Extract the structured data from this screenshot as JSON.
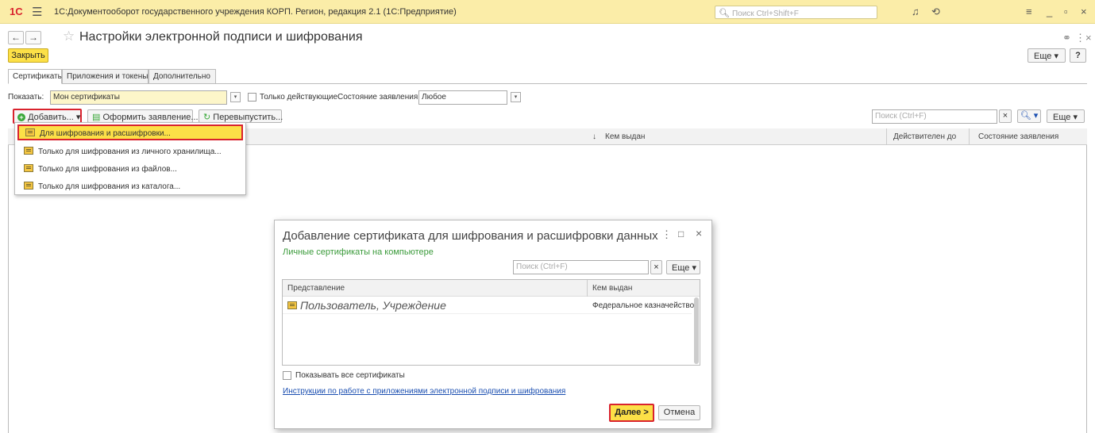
{
  "window": {
    "logo": "1С",
    "title": "1С:Документооборот государственного учреждения КОРП. Регион, редакция 2.1  (1С:Предприятие)",
    "search_placeholder": "Поиск Ctrl+Shift+F"
  },
  "page": {
    "title": "Настройки электронной подписи и шифрования",
    "close_label": "Закрыть",
    "more_label": "Еще",
    "help_label": "?"
  },
  "tabs": [
    {
      "label": "Сертификаты",
      "active": true
    },
    {
      "label": "Приложения и токены",
      "active": false
    },
    {
      "label": "Дополнительно",
      "active": false
    }
  ],
  "filter": {
    "show_label": "Показать:",
    "show_value": "Мон сертификаты",
    "only_active_label": "Только действующие",
    "state_label": "Состояние заявления:",
    "state_value": "Любое"
  },
  "toolbar": {
    "add_label": "Добавить...",
    "apply_label": "Оформить заявление...",
    "reissue_label": "Перевыпустить...",
    "search_placeholder": "Поиск (Ctrl+F)",
    "clear_label": "×",
    "more_label": "Еще"
  },
  "grid": {
    "columns": [
      "Кем выдан",
      "Действителен до",
      "Состояние заявления"
    ],
    "sort_indicator": "↓"
  },
  "add_menu": [
    {
      "label": "Для шифрования и расшифровки...",
      "highlighted": true
    },
    {
      "label": "Только для шифрования из личного хранилища...",
      "highlighted": false
    },
    {
      "label": "Только для шифрования из файлов...",
      "highlighted": false
    },
    {
      "label": "Только для шифрования из каталога...",
      "highlighted": false
    }
  ],
  "dialog": {
    "title": "Добавление сертификата для шифрования и расшифровки данных",
    "subtitle": "Личные сертификаты на компьютере",
    "search_placeholder": "Поиск (Ctrl+F)",
    "clear_label": "×",
    "more_label": "Еще",
    "columns": [
      "Представление",
      "Кем выдан"
    ],
    "rows": [
      {
        "name": "Пользователь, Учреждение",
        "issuer": "Федеральное казначейство"
      }
    ],
    "show_all_label": "Показывать все сертификаты",
    "instructions_link": "Инструкции по работе с приложениями электронной подписи и шифрования",
    "next_label": "Далее >",
    "cancel_label": "Отмена"
  },
  "colors": {
    "titlebar_bg": "#fbeda8",
    "accent_yellow": "#fce047",
    "highlight_red": "#d9232e",
    "subtitle_green": "#3a9a3a",
    "link_blue": "#1a4eb0"
  }
}
